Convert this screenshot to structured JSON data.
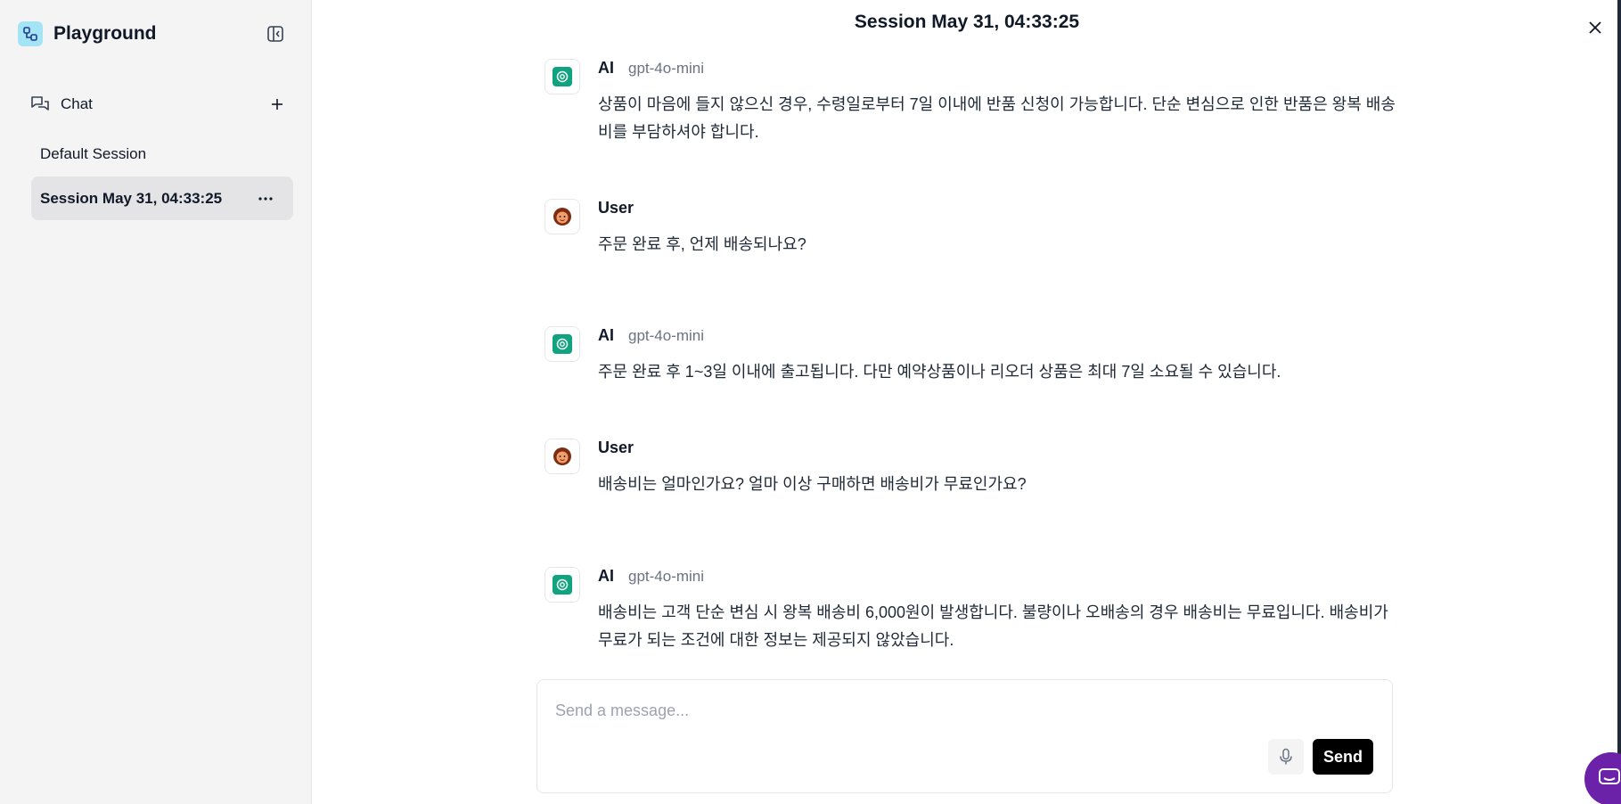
{
  "sidebar": {
    "brand_title": "Playground",
    "brand_logo_color": "#a5e4f5",
    "section_label": "Chat",
    "sessions": [
      {
        "label": "Default Session",
        "active": false
      },
      {
        "label": "Session May 31, 04:33:25",
        "active": true
      }
    ],
    "icons": [
      "sidebar-collapse-icon",
      "chat-bubbles-icon",
      "plus-icon",
      "more-horizontal-icon"
    ]
  },
  "header": {
    "title": "Session May 31, 04:33:25"
  },
  "messages": [
    {
      "role": "AI",
      "model": "gpt-4o-mini",
      "text": "상품이 마음에 들지 않으신 경우, 수령일로부터 7일 이내에 반품 신청이 가능합니다. 단순 변심으로 인한 반품은 왕복 배송비를 부담하셔야 합니다."
    },
    {
      "role": "User",
      "model": "",
      "text": "주문 완료 후, 언제 배송되나요?"
    },
    {
      "role": "AI",
      "model": "gpt-4o-mini",
      "text": "주문 완료 후 1~3일 이내에 출고됩니다. 다만 예약상품이나 리오더 상품은 최대 7일 소요될 수 있습니다."
    },
    {
      "role": "User",
      "model": "",
      "text": "배송비는 얼마인가요? 얼마 이상 구매하면 배송비가 무료인가요?"
    },
    {
      "role": "AI",
      "model": "gpt-4o-mini",
      "text": "배송비는 고객 단순 변심 시 왕복 배송비 6,000원이 발생합니다. 불량이나 오배송의 경우 배송비는 무료입니다. 배송비가 무료가 되는 조건에 대한 정보는 제공되지 않았습니다."
    }
  ],
  "composer": {
    "placeholder": "Send a message...",
    "value": "",
    "send_label": "Send"
  },
  "colors": {
    "ai_avatar": "#10a37f",
    "send_button": "#000000",
    "active_session_bg": "#e4e4e7",
    "support_bubble": "#6b21a8"
  }
}
